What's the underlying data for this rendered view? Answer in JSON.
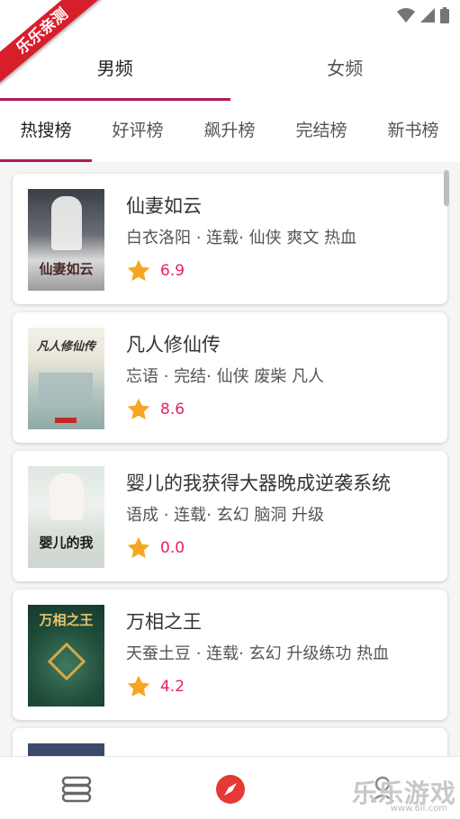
{
  "ribbon": {
    "label": "乐乐亲测"
  },
  "gender_tabs": [
    {
      "label": "男频",
      "active": true
    },
    {
      "label": "女频",
      "active": false
    }
  ],
  "rank_tabs": [
    {
      "label": "热搜榜",
      "active": true
    },
    {
      "label": "好评榜",
      "active": false
    },
    {
      "label": "飙升榜",
      "active": false
    },
    {
      "label": "完结榜",
      "active": false
    },
    {
      "label": "新书榜",
      "active": false
    }
  ],
  "books": [
    {
      "title": "仙妻如云",
      "meta": "白衣洛阳 · 连载· 仙侠 爽文 热血",
      "rating": "6.9",
      "cover_text": "仙妻如云"
    },
    {
      "title": "凡人修仙传",
      "meta": "忘语 · 完结· 仙侠 废柴 凡人",
      "rating": "8.6",
      "cover_text": "凡人修仙传"
    },
    {
      "title": "婴儿的我获得大器晚成逆袭系统",
      "meta": "语成 · 连载· 玄幻 脑洞 升级",
      "rating": "0.0",
      "cover_text": "婴儿的我"
    },
    {
      "title": "万相之王",
      "meta": "天蚕土豆 · 连载· 玄幻 升级练功 热血",
      "rating": "4.2",
      "cover_text": "万相之王"
    }
  ],
  "watermark": {
    "main": "乐乐游戏",
    "sub": "www.6ll.com"
  },
  "colors": {
    "accent": "#b0195a",
    "rating": "#e91e63",
    "star": "#f5a623",
    "nav_active": "#e53935"
  }
}
